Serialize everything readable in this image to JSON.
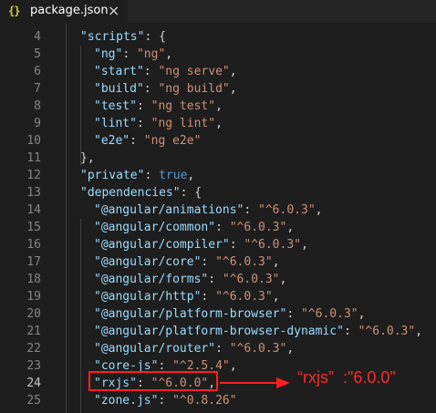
{
  "tab": {
    "icon_glyph": "{}",
    "title": "package.json",
    "close_glyph": "×"
  },
  "lines": [
    {
      "n": "4",
      "indent": 1,
      "parts": [
        [
          "k",
          "\"scripts\""
        ],
        [
          "p",
          ": {"
        ]
      ]
    },
    {
      "n": "5",
      "indent": 2,
      "parts": [
        [
          "k",
          "\"ng\""
        ],
        [
          "p",
          ": "
        ],
        [
          "s",
          "\"ng\""
        ],
        [
          "p",
          ","
        ]
      ]
    },
    {
      "n": "6",
      "indent": 2,
      "parts": [
        [
          "k",
          "\"start\""
        ],
        [
          "p",
          ": "
        ],
        [
          "s",
          "\"ng serve\""
        ],
        [
          "p",
          ","
        ]
      ]
    },
    {
      "n": "7",
      "indent": 2,
      "parts": [
        [
          "k",
          "\"build\""
        ],
        [
          "p",
          ": "
        ],
        [
          "s",
          "\"ng build\""
        ],
        [
          "p",
          ","
        ]
      ]
    },
    {
      "n": "8",
      "indent": 2,
      "parts": [
        [
          "k",
          "\"test\""
        ],
        [
          "p",
          ": "
        ],
        [
          "s",
          "\"ng test\""
        ],
        [
          "p",
          ","
        ]
      ]
    },
    {
      "n": "9",
      "indent": 2,
      "parts": [
        [
          "k",
          "\"lint\""
        ],
        [
          "p",
          ": "
        ],
        [
          "s",
          "\"ng lint\""
        ],
        [
          "p",
          ","
        ]
      ]
    },
    {
      "n": "10",
      "indent": 2,
      "parts": [
        [
          "k",
          "\"e2e\""
        ],
        [
          "p",
          ": "
        ],
        [
          "s",
          "\"ng e2e\""
        ]
      ]
    },
    {
      "n": "11",
      "indent": 1,
      "parts": [
        [
          "p",
          "},"
        ]
      ]
    },
    {
      "n": "12",
      "indent": 1,
      "parts": [
        [
          "k",
          "\"private\""
        ],
        [
          "p",
          ": "
        ],
        [
          "b",
          "true"
        ],
        [
          "p",
          ","
        ]
      ]
    },
    {
      "n": "13",
      "indent": 1,
      "parts": [
        [
          "k",
          "\"dependencies\""
        ],
        [
          "p",
          ": {"
        ]
      ]
    },
    {
      "n": "14",
      "indent": 2,
      "parts": [
        [
          "k",
          "\"@angular/animations\""
        ],
        [
          "p",
          ": "
        ],
        [
          "s",
          "\"^6.0.3\""
        ],
        [
          "p",
          ","
        ]
      ]
    },
    {
      "n": "15",
      "indent": 2,
      "parts": [
        [
          "k",
          "\"@angular/common\""
        ],
        [
          "p",
          ": "
        ],
        [
          "s",
          "\"^6.0.3\""
        ],
        [
          "p",
          ","
        ]
      ]
    },
    {
      "n": "16",
      "indent": 2,
      "parts": [
        [
          "k",
          "\"@angular/compiler\""
        ],
        [
          "p",
          ": "
        ],
        [
          "s",
          "\"^6.0.3\""
        ],
        [
          "p",
          ","
        ]
      ]
    },
    {
      "n": "17",
      "indent": 2,
      "parts": [
        [
          "k",
          "\"@angular/core\""
        ],
        [
          "p",
          ": "
        ],
        [
          "s",
          "\"^6.0.3\""
        ],
        [
          "p",
          ","
        ]
      ]
    },
    {
      "n": "18",
      "indent": 2,
      "parts": [
        [
          "k",
          "\"@angular/forms\""
        ],
        [
          "p",
          ": "
        ],
        [
          "s",
          "\"^6.0.3\""
        ],
        [
          "p",
          ","
        ]
      ]
    },
    {
      "n": "19",
      "indent": 2,
      "parts": [
        [
          "k",
          "\"@angular/http\""
        ],
        [
          "p",
          ": "
        ],
        [
          "s",
          "\"^6.0.3\""
        ],
        [
          "p",
          ","
        ]
      ]
    },
    {
      "n": "20",
      "indent": 2,
      "parts": [
        [
          "k",
          "\"@angular/platform-browser\""
        ],
        [
          "p",
          ": "
        ],
        [
          "s",
          "\"^6.0.3\""
        ],
        [
          "p",
          ","
        ]
      ]
    },
    {
      "n": "21",
      "indent": 2,
      "parts": [
        [
          "k",
          "\"@angular/platform-browser-dynamic\""
        ],
        [
          "p",
          ": "
        ],
        [
          "s",
          "\"^6.0.3\""
        ],
        [
          "p",
          ","
        ]
      ]
    },
    {
      "n": "22",
      "indent": 2,
      "parts": [
        [
          "k",
          "\"@angular/router\""
        ],
        [
          "p",
          ": "
        ],
        [
          "s",
          "\"^6.0.3\""
        ],
        [
          "p",
          ","
        ]
      ]
    },
    {
      "n": "23",
      "indent": 2,
      "parts": [
        [
          "k",
          "\"core-js\""
        ],
        [
          "p",
          ": "
        ],
        [
          "s",
          "\"^2.5.4\""
        ],
        [
          "p",
          ","
        ]
      ]
    },
    {
      "n": "24",
      "indent": 2,
      "parts": [
        [
          "k",
          "\"rxjs\""
        ],
        [
          "p",
          ": "
        ],
        [
          "s",
          "\"^6.0.0\""
        ],
        [
          "p",
          ","
        ]
      ]
    },
    {
      "n": "25",
      "indent": 2,
      "parts": [
        [
          "k",
          "\"zone.js\""
        ],
        [
          "p",
          ": "
        ],
        [
          "s",
          "\"^0.8.26\""
        ]
      ]
    }
  ],
  "active_line": "24",
  "annotation": {
    "text": "“rxjs”  :\"6.0.0\"",
    "color": "#ff2a2a"
  },
  "colors": {
    "background": "#1e1e1e",
    "key": "#9cdcfe",
    "string": "#ce9178",
    "punctuation": "#d4d4d4",
    "boolean": "#569cd6",
    "line_number": "#858585",
    "highlight_box": "#ff1f1f"
  }
}
